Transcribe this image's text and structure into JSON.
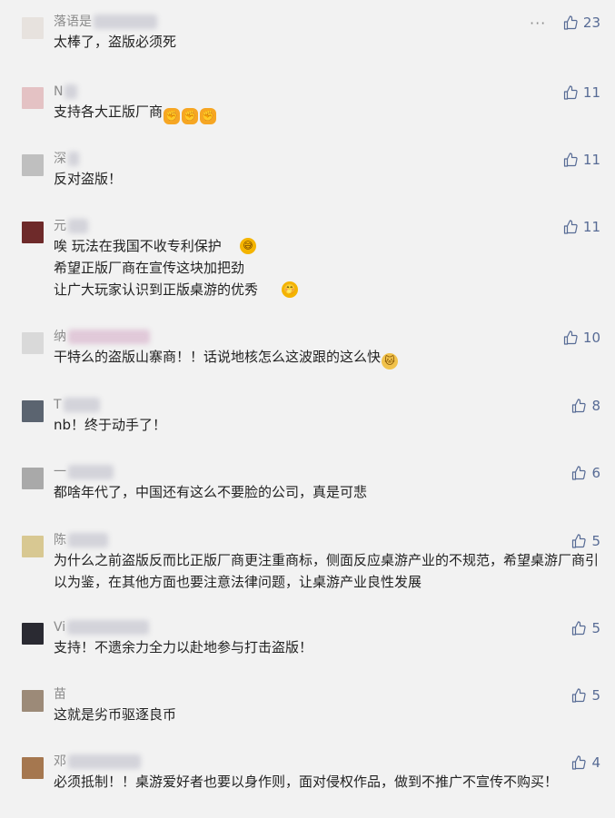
{
  "comments": [
    {
      "name": "落语是",
      "text": "太棒了，盗版必须死",
      "likes": "23",
      "avatar_color": "#e7e2de",
      "more": "···",
      "emoji": []
    },
    {
      "name": "N",
      "text": "支持各大正版厂商",
      "likes": "11",
      "avatar_color": "#e4c2c4",
      "emoji": [
        "fist-icon",
        "fist-icon",
        "fist-icon"
      ]
    },
    {
      "name": "深",
      "text": "反对盗版！",
      "likes": "11",
      "avatar_color": "#bfbfbf",
      "emoji": []
    },
    {
      "name": "元",
      "text": "唉 玩法在我国不收专利保护\n希望正版厂商在宣传这块加把劲\n让广大玩家认识到正版桌游的优秀",
      "likes": "11",
      "avatar_color": "#6e2a2a",
      "emoji": []
    },
    {
      "name": "纳",
      "text": "干特么的盗版山寨商！！话说地核怎么这波跟的这么快",
      "likes": "10",
      "avatar_color": "#d9d9d9",
      "emoji": [
        "cat-icon"
      ]
    },
    {
      "name": "T",
      "text": "nb！终于动手了！",
      "likes": "8",
      "avatar_color": "#5b6470",
      "emoji": []
    },
    {
      "name": "一",
      "text": "都啥年代了，中国还有这么不要脸的公司，真是可悲",
      "likes": "6",
      "avatar_color": "#a9a9a9",
      "emoji": []
    },
    {
      "name": "陈",
      "text": "为什么之前盗版反而比正版厂商更注重商标，侧面反应桌游产业的不规范，希望桌游厂商引以为鉴，在其他方面也要注意法律问题，让桌游产业良性发展",
      "likes": "5",
      "avatar_color": "#d8c892",
      "emoji": []
    },
    {
      "name": "Vi",
      "text": "支持！不遗余力全力以赴地参与打击盗版！",
      "likes": "5",
      "avatar_color": "#2a2a32",
      "emoji": []
    },
    {
      "name": "苗",
      "text": "这就是劣币驱逐良币",
      "likes": "5",
      "avatar_color": "#9c8a78",
      "emoji": []
    },
    {
      "name": "邓",
      "text": "必须抵制！！桌游爱好者也要以身作则，面对侵权作品，做到不推广不宣传不购买！",
      "likes": "4",
      "avatar_color": "#a5774f",
      "emoji": []
    }
  ],
  "colors": {
    "like": "#576b95",
    "background": "#f2f2f2",
    "name": "#8a8a8a"
  }
}
